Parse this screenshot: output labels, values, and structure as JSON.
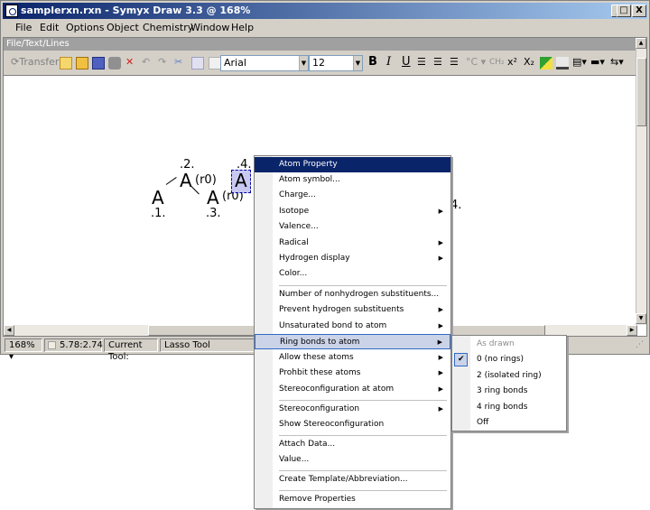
{
  "window": {
    "title": "samplerxn.rxn - Symyx Draw 3.3 @ 168%",
    "controls": [
      "_",
      "□",
      "X"
    ]
  },
  "menubar": [
    "File",
    "Edit",
    "Options",
    "Object",
    "Chemistry",
    "Window",
    "Help"
  ],
  "textbar": {
    "title": "File/Text/Lines"
  },
  "toolbar": {
    "transfer_label": "Transfer",
    "font_name": "Arial",
    "font_size": "12",
    "bold": "B",
    "italic": "I",
    "underline": "U",
    "superscript": "x²",
    "subscript": "X₂"
  },
  "drawing": {
    "atoms": [
      "A",
      "A",
      "A",
      "A"
    ],
    "labels": [
      ".2.",
      ".1.",
      ".3.",
      ".4.",
      "(r0)",
      "(r0)",
      "4."
    ]
  },
  "statusbar": {
    "zoom": "168%",
    "coords": "5.78:2.74",
    "current_tool_label": "Current Tool:",
    "current_tool": "Lasso Tool"
  },
  "context_menu": {
    "items": [
      {
        "label": "Atom Property",
        "sub": false
      },
      {
        "label": "Atom symbol...",
        "sub": false
      },
      {
        "label": "Charge...",
        "sub": false
      },
      {
        "label": "Isotope",
        "sub": true
      },
      {
        "label": "Valence...",
        "sub": false
      },
      {
        "label": "Radical",
        "sub": true
      },
      {
        "label": "Hydrogen display",
        "sub": true
      },
      {
        "label": "Color...",
        "sub": false
      },
      {
        "label": "Number of nonhydrogen substituents...",
        "sub": false
      },
      {
        "label": "Prevent hydrogen substituents",
        "sub": true
      },
      {
        "label": "Unsaturated bond to atom",
        "sub": true
      },
      {
        "label": "Ring bonds to atom",
        "sub": true
      },
      {
        "label": "Allow these atoms",
        "sub": true
      },
      {
        "label": "Prohbit these atoms",
        "sub": true
      },
      {
        "label": "Stereoconfiguration at atom",
        "sub": true
      },
      {
        "label": "Stereoconfiguration",
        "sub": true
      },
      {
        "label": "Show Stereoconfiguration",
        "sub": false
      },
      {
        "label": "Attach Data...",
        "sub": false
      },
      {
        "label": "Value...",
        "sub": false
      },
      {
        "label": "Create Template/Abbreviation...",
        "sub": false
      },
      {
        "label": "Remove Properties",
        "sub": false
      }
    ]
  },
  "submenu": {
    "items": [
      {
        "label": "As drawn",
        "disabled": true,
        "checked": false
      },
      {
        "label": "0 (no rings)",
        "disabled": false,
        "checked": true
      },
      {
        "label": "2 (isolated ring)",
        "disabled": false,
        "checked": false
      },
      {
        "label": "3 ring bonds",
        "disabled": false,
        "checked": false
      },
      {
        "label": "4 ring bonds",
        "disabled": false,
        "checked": false
      },
      {
        "label": "Off",
        "disabled": false,
        "checked": false
      }
    ]
  },
  "colors": {
    "titlebar_start": "#0a246a",
    "titlebar_end": "#a6caf0",
    "selection": "#c8c8f0",
    "menu_highlight": "#0a246a"
  }
}
